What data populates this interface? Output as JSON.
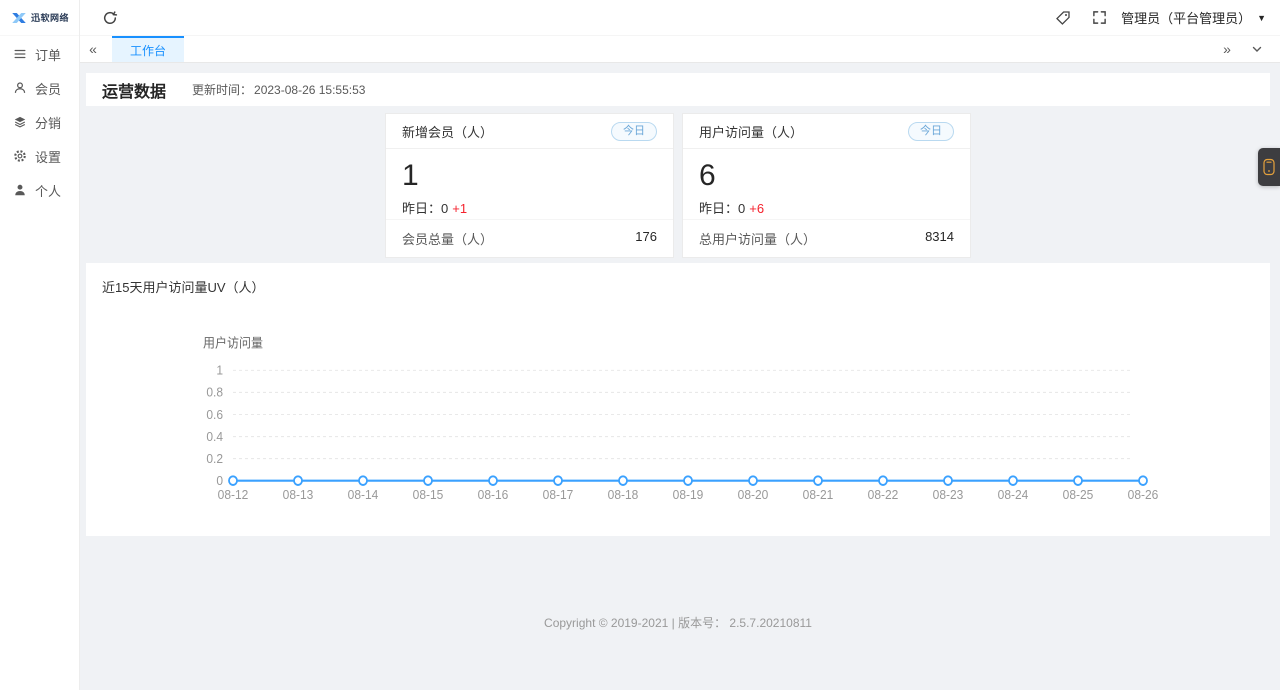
{
  "colors": {
    "accent_blue": "#1890ff",
    "chart_line": "#3aa1ff",
    "delta_red": "#f5222d",
    "tab_active_bg": "#e6f4ff",
    "badge_border": "#b9d9f0",
    "widget_icon_orange": "#e6a23c",
    "content_bg": "#f0f2f5"
  },
  "icons": [
    "logo-mark-icon",
    "order-list-icon",
    "member-user-icon",
    "distribution-layers-icon",
    "settings-gear-icon",
    "profile-person-icon",
    "refresh-icon",
    "tag-icon",
    "fullscreen-icon",
    "caret-down-icon",
    "chevrons-left-icon",
    "chevrons-right-icon",
    "chevron-down-icon",
    "service-phone-icon"
  ],
  "sidebar": {
    "logo_text": "迅软网络",
    "items": [
      {
        "label": "订单",
        "icon": "order-list-icon"
      },
      {
        "label": "会员",
        "icon": "member-user-icon"
      },
      {
        "label": "分销",
        "icon": "distribution-layers-icon"
      },
      {
        "label": "设置",
        "icon": "settings-gear-icon"
      },
      {
        "label": "个人",
        "icon": "profile-person-icon"
      }
    ]
  },
  "topbar": {
    "user_label": "管理员（平台管理员）"
  },
  "tabbar": {
    "active_tab": "工作台"
  },
  "main": {
    "section_title": "运营数据",
    "update_time_label": "更新时间：",
    "update_time": "2023-08-26 15:55:53",
    "cards": [
      {
        "title": "新增会员（人）",
        "badge": "今日",
        "value": "1",
        "yesterday_label": "昨日：",
        "yesterday_value": "0",
        "delta": "+1",
        "footer_label": "会员总量（人）",
        "footer_value": "176"
      },
      {
        "title": "用户访问量（人）",
        "badge": "今日",
        "value": "6",
        "yesterday_label": "昨日：",
        "yesterday_value": "0",
        "delta": "+6",
        "footer_label": "总用户访问量（人）",
        "footer_value": "8314"
      }
    ],
    "chart_panel_title": "近15天用户访问量UV（人）"
  },
  "chart_data": {
    "type": "line",
    "title": "近15天用户访问量UV（人）",
    "ylabel": "用户访问量",
    "x": [
      "08-12",
      "08-13",
      "08-14",
      "08-15",
      "08-16",
      "08-17",
      "08-18",
      "08-19",
      "08-20",
      "08-21",
      "08-22",
      "08-23",
      "08-24",
      "08-25",
      "08-26"
    ],
    "series": [
      {
        "name": "用户访问量",
        "values": [
          0,
          0,
          0,
          0,
          0,
          0,
          0,
          0,
          0,
          0,
          0,
          0,
          0,
          0,
          0
        ]
      }
    ],
    "ylim": [
      0,
      1
    ],
    "yticks": [
      0,
      0.2,
      0.4,
      0.6,
      0.8,
      1
    ],
    "grid": "horizontal-dotted",
    "legend_position": "y-axis-top",
    "line_color": "#3aa1ff",
    "marker": "hollow-circle"
  },
  "footer": {
    "text": "Copyright © 2019-2021  |  版本号： 2.5.7.20210811"
  }
}
